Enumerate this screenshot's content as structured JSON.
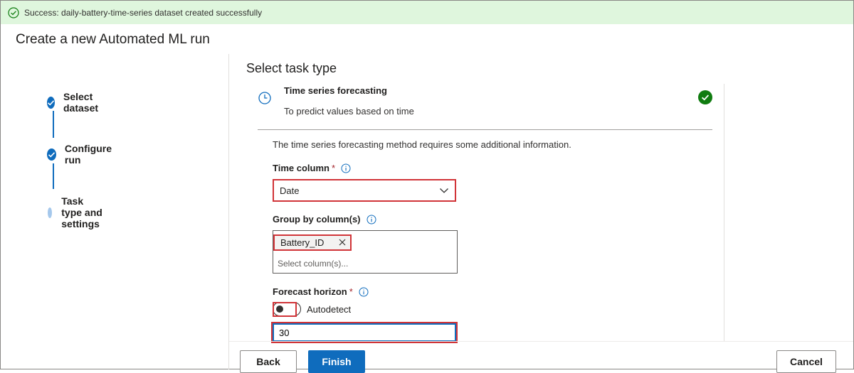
{
  "banner": {
    "message": "Success: daily-battery-time-series dataset created successfully",
    "status_color": "#107c10"
  },
  "page": {
    "title": "Create a new Automated ML run"
  },
  "wizard": {
    "steps": [
      {
        "label": "Select dataset",
        "state": "completed"
      },
      {
        "label": "Configure run",
        "state": "completed"
      },
      {
        "label": "Task type and settings",
        "state": "current"
      }
    ]
  },
  "section": {
    "title": "Select task type"
  },
  "task": {
    "name": "Time series forecasting",
    "description": "To predict values based on time",
    "icon": "clock-icon",
    "selected": true
  },
  "settings": {
    "info": "The time series forecasting method requires some additional information.",
    "time_column": {
      "label": "Time column",
      "required": "*",
      "value": "Date"
    },
    "group_by": {
      "label": "Group by column(s)",
      "chips": [
        "Battery_ID"
      ],
      "placeholder": "Select column(s)..."
    },
    "forecast_horizon": {
      "label": "Forecast horizon",
      "required": "*",
      "toggle_label": "Autodetect",
      "toggle_on": false,
      "value": "30"
    }
  },
  "footer": {
    "back": "Back",
    "finish": "Finish",
    "cancel": "Cancel"
  },
  "colors": {
    "accent": "#0f6cbd",
    "highlight": "#d13438",
    "success_bg": "#dff6dd"
  }
}
